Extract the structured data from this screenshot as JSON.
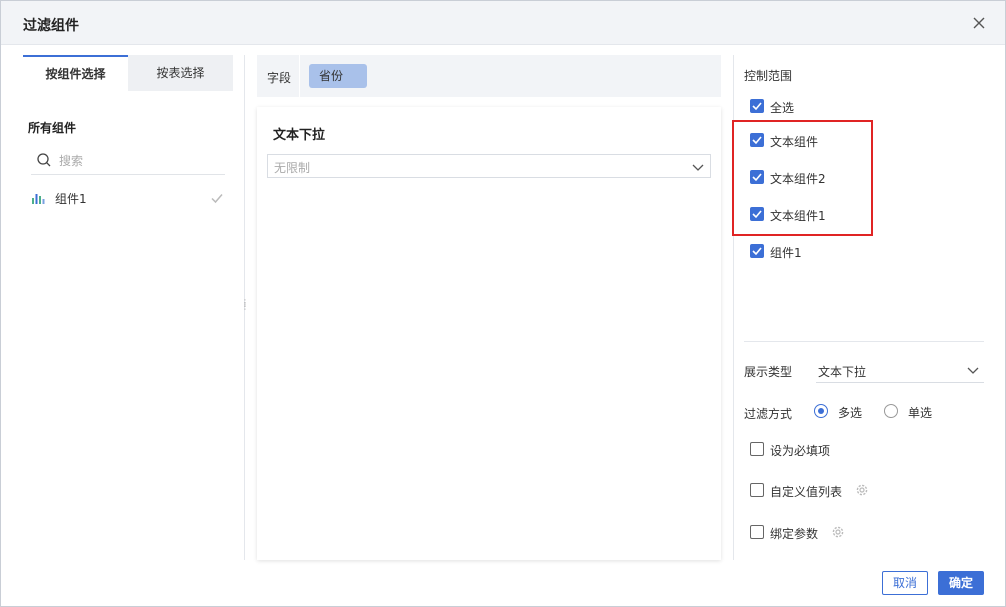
{
  "dialog": {
    "title": "过滤组件",
    "close_icon": "close-icon"
  },
  "left_panel": {
    "tabs": [
      {
        "label": "按组件选择",
        "active": true
      },
      {
        "label": "按表选择",
        "active": false
      }
    ],
    "section_label": "所有组件",
    "search": {
      "placeholder": "搜索",
      "value": ""
    },
    "components": [
      {
        "label": "组件1",
        "icon": "bar-chart-icon",
        "selected": true
      }
    ]
  },
  "middle_panel": {
    "field_label": "字段",
    "field_chip": "省份",
    "preview_title": "文本下拉",
    "preview_select_placeholder": "无限制"
  },
  "right_panel": {
    "control_scope_label": "控制范围",
    "scope_items": [
      {
        "label": "全选",
        "checked": true
      },
      {
        "label": "文本组件",
        "checked": true
      },
      {
        "label": "文本组件2",
        "checked": true
      },
      {
        "label": "文本组件1",
        "checked": true
      },
      {
        "label": "组件1",
        "checked": true
      }
    ],
    "display_type_label": "展示类型",
    "display_type_value": "文本下拉",
    "filter_mode_label": "过滤方式",
    "filter_modes": [
      {
        "label": "多选",
        "selected": true
      },
      {
        "label": "单选",
        "selected": false
      }
    ],
    "options": [
      {
        "label": "设为必填项",
        "checked": false,
        "has_gear": false
      },
      {
        "label": "自定义值列表",
        "checked": false,
        "has_gear": true
      },
      {
        "label": "绑定参数",
        "checked": false,
        "has_gear": true
      }
    ]
  },
  "footer": {
    "cancel_label": "取消",
    "ok_label": "确定"
  },
  "colors": {
    "accent": "#3c6fd6",
    "chip": "#a9c1ea",
    "highlight": "#e02424",
    "header_bg": "#f2f4f7"
  }
}
